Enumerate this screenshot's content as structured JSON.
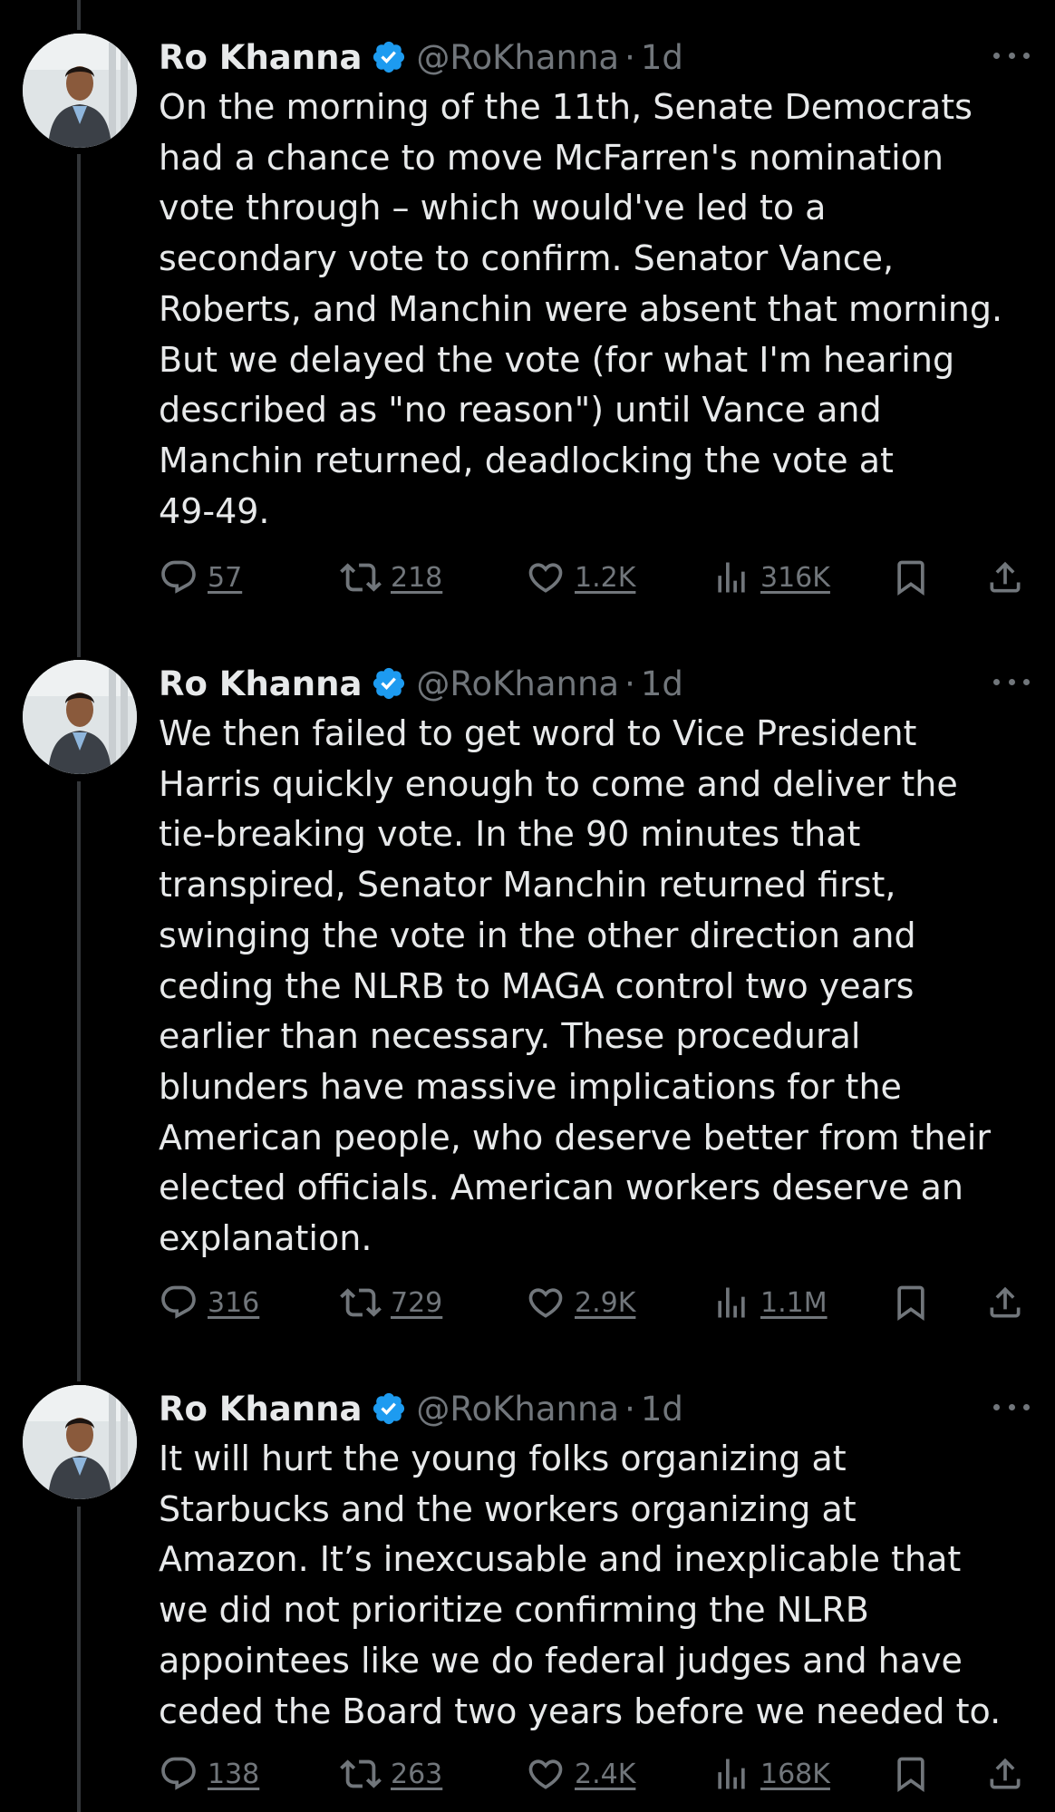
{
  "tweets": [
    {
      "name": "Ro Khanna",
      "handle": "@RoKhanna",
      "separator": "·",
      "time": "1d",
      "text": "On the morning of the 11th, Senate Democrats\nhad a chance to move McFarren's nomination\nvote through – which would've led to a\nsecondary vote to confirm. Senator Vance,\nRoberts, and Manchin were absent that morning.\nBut we delayed the vote (for what I'm hearing\ndescribed as \"no reason\") until Vance and\nManchin returned, deadlocking the vote at\n49-49.",
      "replies": "57",
      "reposts": "218",
      "likes": "1.2K",
      "views": "316K"
    },
    {
      "name": "Ro Khanna",
      "handle": "@RoKhanna",
      "separator": "·",
      "time": "1d",
      "text": "We then failed to get word to Vice President\nHarris quickly enough to come and deliver the\ntie-breaking vote. In the 90 minutes that\ntranspired, Senator Manchin returned first,\nswinging the vote in the other direction and\nceding the NLRB to MAGA control two years\nearlier than necessary. These procedural\nblunders have massive implications for the\nAmerican people, who deserve better from their\nelected officials. American workers deserve an\nexplanation.",
      "replies": "316",
      "reposts": "729",
      "likes": "2.9K",
      "views": "1.1M"
    },
    {
      "name": "Ro Khanna",
      "handle": "@RoKhanna",
      "separator": "·",
      "time": "1d",
      "text": "It will hurt the young folks organizing at\nStarbucks and the workers organizing at\nAmazon. It’s inexcusable and inexplicable that\nwe did not prioritize confirming the NLRB\nappointees like we do federal judges and have\nceded the Board two years before we needed to.",
      "replies": "138",
      "reposts": "263",
      "likes": "2.4K",
      "views": "168K"
    }
  ],
  "icons": {
    "reply": "reply-icon",
    "repost": "repost-icon",
    "like": "heart-icon",
    "views": "views-icon",
    "bookmark": "bookmark-icon",
    "share": "share-icon",
    "verified": "verified-badge-icon",
    "more": "more-icon"
  },
  "colors": {
    "background": "#000000",
    "text": "#e7e9ea",
    "secondary": "#71767b",
    "verified": "#1d9bf0",
    "thread_line": "#333639"
  }
}
